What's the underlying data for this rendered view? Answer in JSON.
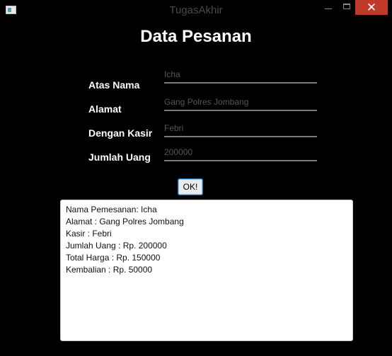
{
  "window": {
    "title": "TugasAkhir",
    "close_glyph": "✕"
  },
  "heading": "Data Pesanan",
  "form": {
    "fields": [
      {
        "label": "Atas Nama",
        "value": "Icha"
      },
      {
        "label": "Alamat",
        "value": "Gang Polres Jombang"
      },
      {
        "label": "Dengan Kasir",
        "value": "Febri"
      },
      {
        "label": "Jumlah Uang",
        "value": "200000"
      }
    ],
    "ok_label": "OK!"
  },
  "output_lines": [
    "Nama Pemesanan: Icha",
    "Alamat : Gang Polres Jombang",
    "Kasir : Febri",
    "Jumlah Uang : Rp. 200000",
    "Total Harga : Rp. 150000",
    "Kembalian : Rp. 50000"
  ],
  "colors": {
    "close_button": "#c0392b",
    "ok_border": "#1f6fb5"
  }
}
